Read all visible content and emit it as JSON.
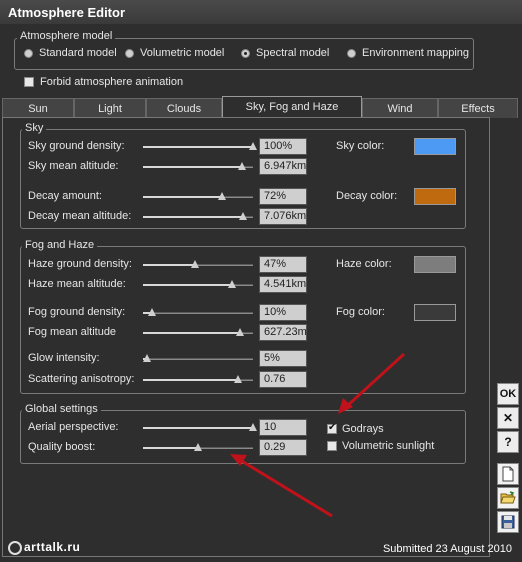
{
  "window": {
    "title": "Atmosphere Editor"
  },
  "atmosphere_model": {
    "label": "Atmosphere model",
    "options": [
      {
        "label": "Standard model",
        "selected": false
      },
      {
        "label": "Volumetric model",
        "selected": false
      },
      {
        "label": "Spectral model",
        "selected": true
      },
      {
        "label": "Environment mapping",
        "selected": false
      }
    ]
  },
  "forbid_animation": {
    "label": "Forbid atmosphere animation",
    "checked": false
  },
  "tabs": [
    "Sun",
    "Light",
    "Clouds",
    "Sky, Fog and Haze",
    "Wind",
    "Effects"
  ],
  "active_tab": "Sky, Fog and Haze",
  "sky": {
    "label": "Sky",
    "ground_density": {
      "label": "Sky ground density:",
      "value": "100%",
      "level": 1.0
    },
    "mean_altitude": {
      "label": "Sky mean altitude:",
      "value": "6.947km",
      "level": 0.9
    },
    "decay_amount": {
      "label": "Decay amount:",
      "value": "72%",
      "level": 0.72
    },
    "decay_mean_altitude": {
      "label": "Decay mean altitude:",
      "value": "7.076km",
      "level": 0.91
    },
    "sky_color": {
      "label": "Sky color:",
      "color": "#4d9af5"
    },
    "decay_color": {
      "label": "Decay color:",
      "color": "#c06a10"
    }
  },
  "fog_haze": {
    "label": "Fog and Haze",
    "haze_ground_density": {
      "label": "Haze ground density:",
      "value": "47%",
      "level": 0.47
    },
    "haze_mean_altitude": {
      "label": "Haze mean altitude:",
      "value": "4.541km",
      "level": 0.81
    },
    "fog_ground_density": {
      "label": "Fog ground density:",
      "value": "10%",
      "level": 0.08
    },
    "fog_mean_altitude": {
      "label": "Fog mean altitude",
      "value": "627.23m",
      "level": 0.88
    },
    "glow_intensity": {
      "label": "Glow intensity:",
      "value": "5%",
      "level": 0.04
    },
    "scattering_anisotropy": {
      "label": "Scattering anisotropy:",
      "value": "0.76",
      "level": 0.86
    },
    "haze_color": {
      "label": "Haze color:",
      "color": "#7d7d7d"
    },
    "fog_color": {
      "label": "Fog color:",
      "color": "#3a3a3a"
    }
  },
  "global": {
    "label": "Global settings",
    "aerial_perspective": {
      "label": "Aerial perspective:",
      "value": "10",
      "level": 1.0
    },
    "quality_boost": {
      "label": "Quality boost:",
      "value": "0.29",
      "level": 0.5
    },
    "godrays": {
      "label": "Godrays",
      "checked": true
    },
    "volumetric_sunlight": {
      "label": "Volumetric sunlight",
      "checked": false
    }
  },
  "side_buttons": {
    "ok": "OK",
    "close": "✕",
    "help": "?"
  },
  "footer": {
    "logo": "arttalk.ru",
    "submitted": "Submitted 23 August 2010"
  },
  "colors": {
    "window_bg": "#2e2e2e",
    "annotation_arrow": "#c0121a"
  }
}
